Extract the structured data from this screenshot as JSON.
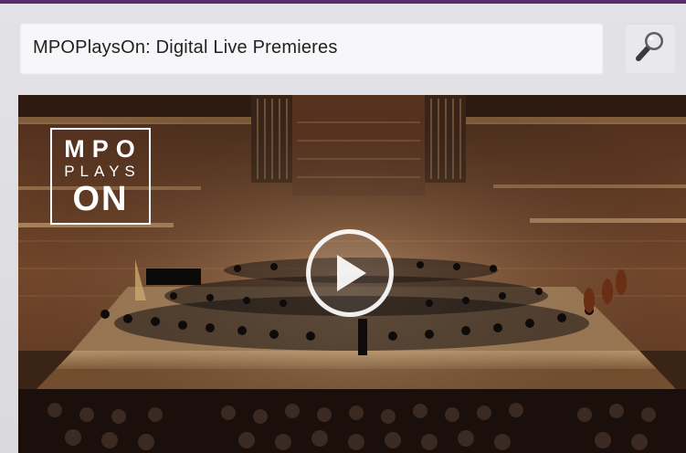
{
  "header": {
    "search_value": "MPOPlaysOn: Digital Live Premieres",
    "search_icon": "magnifier-icon"
  },
  "video": {
    "logo": {
      "line1": "MPO",
      "line2": "PLAYS",
      "line3": "ON"
    },
    "play_icon": "play-icon"
  },
  "colors": {
    "top_border": "#5a2c6e",
    "background": "#e0e0e4",
    "search_bg": "#f7f7f9"
  }
}
